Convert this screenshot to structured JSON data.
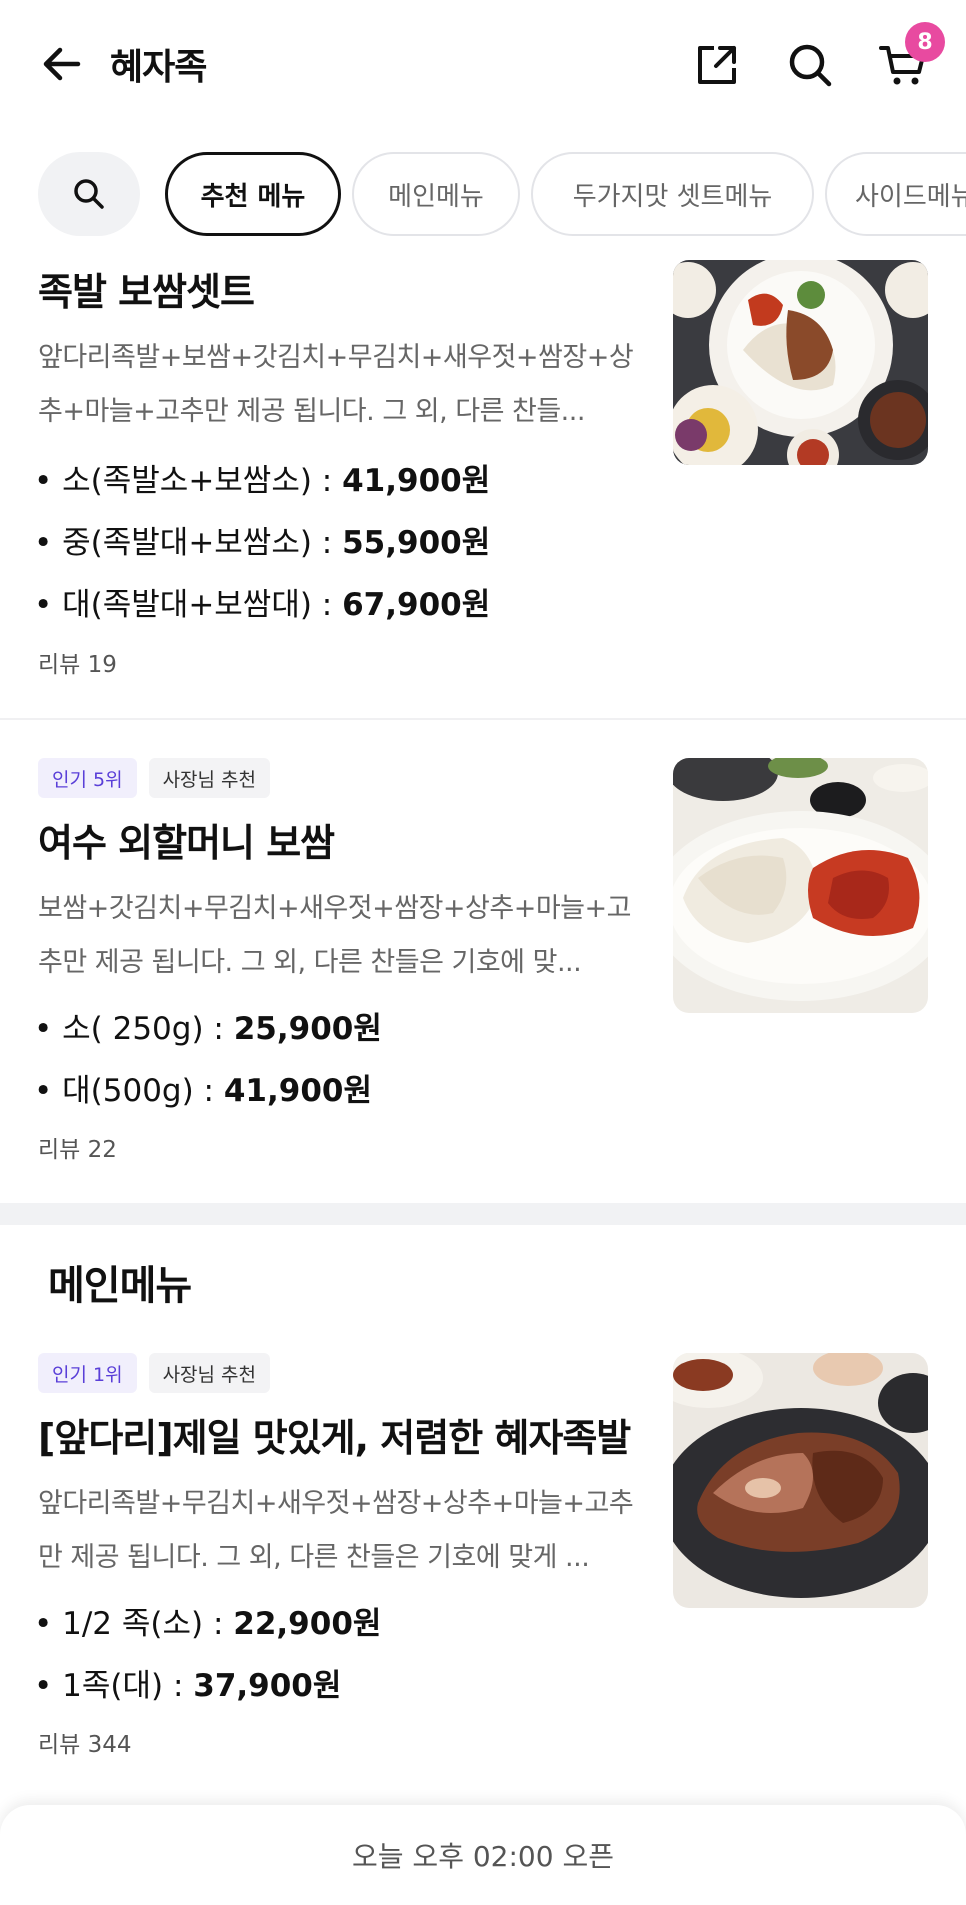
{
  "header": {
    "title": "혜자족",
    "cart_count": "8",
    "icons": [
      "back-arrow-icon",
      "share-icon",
      "search-icon",
      "cart-icon"
    ]
  },
  "tabs": [
    {
      "label": "추천 메뉴",
      "active": true
    },
    {
      "label": "메인메뉴",
      "active": false
    },
    {
      "label": "두가지맛 셋트메뉴",
      "active": false
    },
    {
      "label": "사이드메뉴",
      "active": false
    }
  ],
  "items": [
    {
      "name": "족발 보쌈셋트",
      "desc": "앞다리족발+보쌈+갓김치+무김치+새우젓+쌈장+상추+마늘+고추만 제공 됩니다. 그 외, 다른 찬들...",
      "prices": [
        {
          "label": "• 소(족발소+보쌈소) : ",
          "price": "41,900원"
        },
        {
          "label": "• 중(족발대+보쌈소) : ",
          "price": "55,900원"
        },
        {
          "label": "• 대(족발대+보쌈대) : ",
          "price": "67,900원"
        }
      ],
      "review": "리뷰 19"
    },
    {
      "badges": [
        "인기 5위",
        "사장님 추천"
      ],
      "name": "여수 외할머니 보쌈",
      "desc": "보쌈+갓김치+무김치+새우젓+쌈장+상추+마늘+고추만 제공 됩니다. 그 외, 다른 찬들은 기호에 맞...",
      "prices": [
        {
          "label": "• 소( 250g) : ",
          "price": "25,900원"
        },
        {
          "label": "• 대(500g) : ",
          "price": "41,900원"
        }
      ],
      "review": "리뷰 22"
    }
  ],
  "section": {
    "title": "메인메뉴"
  },
  "main_items": [
    {
      "badges": [
        "인기 1위",
        "사장님 추천"
      ],
      "name": "[앞다리]제일 맛있게, 저렴한 혜자족발",
      "desc": "앞다리족발+무김치+새우젓+쌈장+상추+마늘+고추만 제공 됩니다. 그 외, 다른 찬들은 기호에 맞게 ...",
      "prices": [
        {
          "label": "• 1/2 족(소) : ",
          "price": "22,900원"
        },
        {
          "label": "• 1족(대) : ",
          "price": "37,900원"
        }
      ],
      "review": "리뷰 344"
    }
  ],
  "bottom_bar": {
    "text": "오늘 오후 02:00 오픈"
  },
  "colors": {
    "badge_pink": "#e84aa0",
    "popular_badge_text": "#5a3fd8"
  }
}
